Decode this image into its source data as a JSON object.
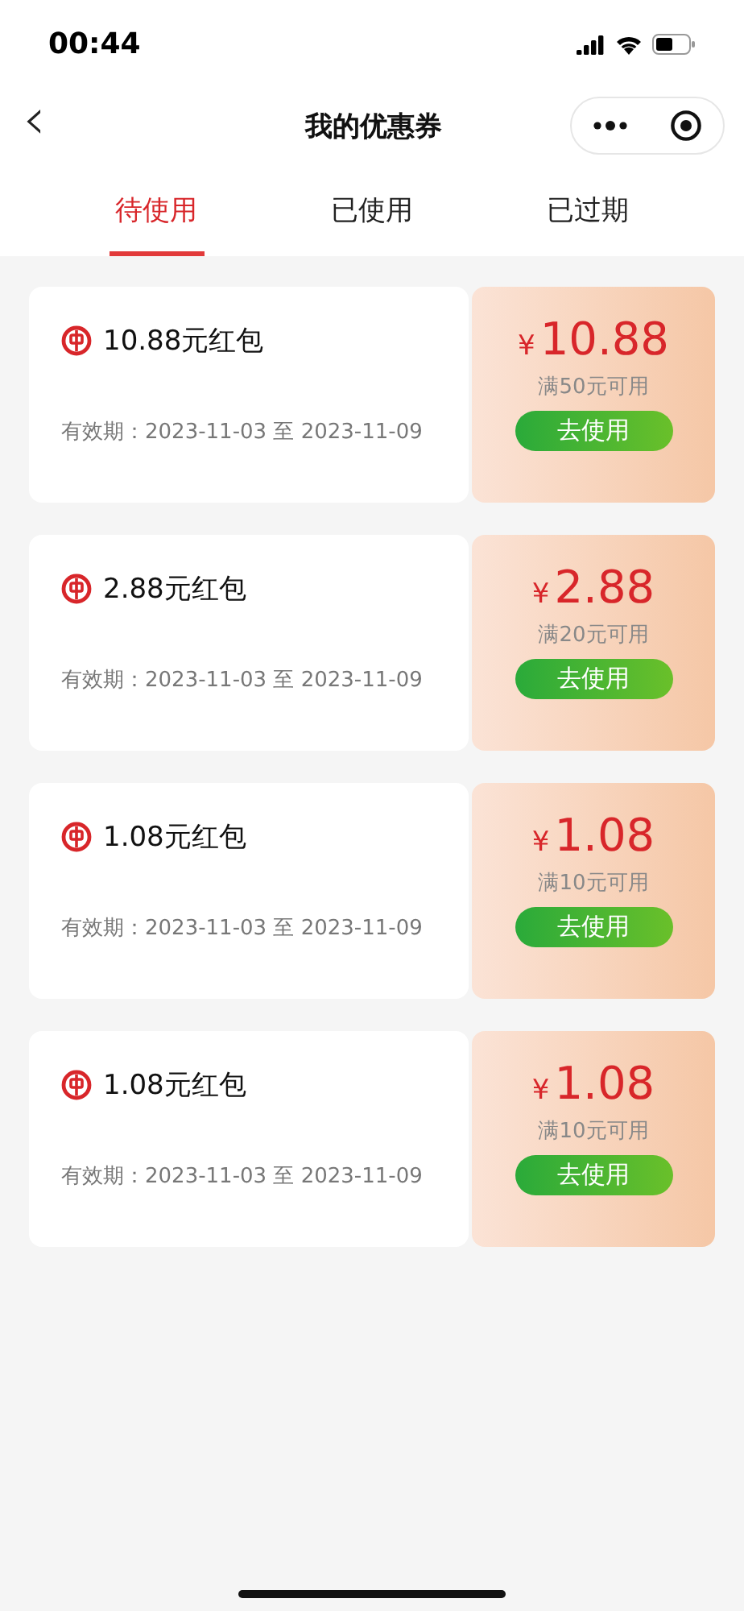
{
  "status_bar": {
    "time": "00:44"
  },
  "nav": {
    "back": "‹",
    "title": "我的优惠券"
  },
  "tabs": [
    {
      "label": "待使用",
      "selected": true
    },
    {
      "label": "已使用",
      "selected": false
    },
    {
      "label": "已过期",
      "selected": false
    }
  ],
  "coupons": [
    {
      "title": "10.88元红包",
      "validity": "有效期：2023-11-03 至 2023-11-09",
      "currency": "¥",
      "amount": "10.88",
      "condition": "满50元可用",
      "button": "去使用"
    },
    {
      "title": "2.88元红包",
      "validity": "有效期：2023-11-03 至 2023-11-09",
      "currency": "¥",
      "amount": "2.88",
      "condition": "满20元可用",
      "button": "去使用"
    },
    {
      "title": "1.08元红包",
      "validity": "有效期：2023-11-03 至 2023-11-09",
      "currency": "¥",
      "amount": "1.08",
      "condition": "满10元可用",
      "button": "去使用"
    },
    {
      "title": "1.08元红包",
      "validity": "有效期：2023-11-03 至 2023-11-09",
      "currency": "¥",
      "amount": "1.08",
      "condition": "满10元可用",
      "button": "去使用"
    }
  ]
}
